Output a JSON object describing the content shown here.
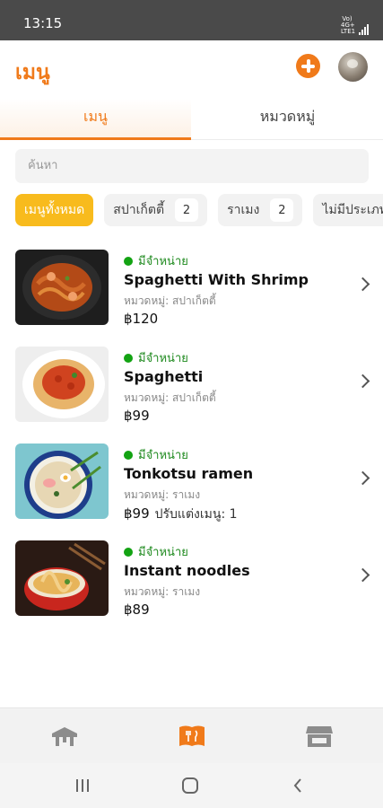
{
  "status_bar": {
    "time": "13:15",
    "network": "Vo) 4G+ LTE1",
    "signal": "signal-icon"
  },
  "header": {
    "title": "เมนู",
    "add_icon": "plus-circle-icon",
    "avatar_icon": "avatar"
  },
  "tabs": [
    {
      "label": "เมนู",
      "active": true
    },
    {
      "label": "หมวดหมู่",
      "active": false
    }
  ],
  "search": {
    "placeholder": "ค้นหา"
  },
  "filters": [
    {
      "label": "เมนูทั้งหมด",
      "count": "",
      "active": true
    },
    {
      "label": "สปาเก็ตตี้",
      "count": "2",
      "active": false
    },
    {
      "label": "ราเมง",
      "count": "2",
      "active": false
    },
    {
      "label": "ไม่มีประเภท",
      "count": "",
      "active": false
    }
  ],
  "menu_items": [
    {
      "status": "มีจำหน่าย",
      "name": "Spaghetti With Shrimp",
      "category": "หมวดหมู่: สปาเก็ตตี้",
      "price": "฿120",
      "options": ""
    },
    {
      "status": "มีจำหน่าย",
      "name": "Spaghetti",
      "category": "หมวดหมู่: สปาเก็ตตี้",
      "price": "฿99",
      "options": ""
    },
    {
      "status": "มีจำหน่าย",
      "name": "Tonkotsu ramen",
      "category": "หมวดหมู่: ราเมง",
      "price": "฿99",
      "options": "ปรับแต่งเมนู: 1"
    },
    {
      "status": "มีจำหน่าย",
      "name": "Instant noodles",
      "category": "หมวดหมู่: ราเมง",
      "price": "฿89",
      "options": ""
    }
  ],
  "bottom_nav": [
    {
      "icon": "table-icon",
      "active": false
    },
    {
      "icon": "menu-book-icon",
      "active": true
    },
    {
      "icon": "store-icon",
      "active": false
    }
  ],
  "system_nav": [
    "recent-apps-icon",
    "home-icon",
    "back-icon"
  ],
  "colors": {
    "accent": "#f07a1a",
    "chip_active": "#f8bb1d",
    "available": "#13a313"
  }
}
